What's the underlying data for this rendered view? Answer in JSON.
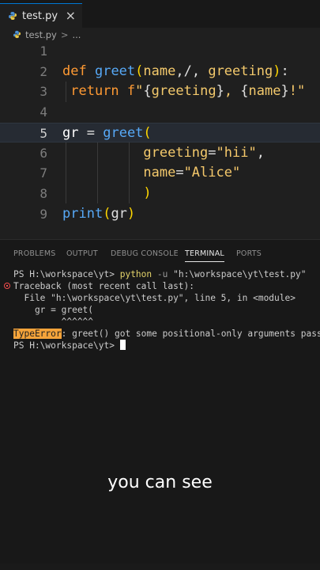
{
  "tab": {
    "label": "test.py",
    "close": "×"
  },
  "breadcrumb": {
    "file": "test.py",
    "separator": ">",
    "more": "..."
  },
  "editor": {
    "lines": [
      {
        "num": "1"
      },
      {
        "num": "2"
      },
      {
        "num": "3"
      },
      {
        "num": "4"
      },
      {
        "num": "5"
      },
      {
        "num": "6"
      },
      {
        "num": "7"
      },
      {
        "num": "8"
      },
      {
        "num": "9"
      }
    ]
  },
  "panel": {
    "tabs": [
      "PROBLEMS",
      "OUTPUT",
      "DEBUG CONSOLE",
      "TERMINAL",
      "PORTS"
    ],
    "active_tab": "TERMINAL"
  },
  "terminal": {
    "prompt1": "PS H:\\workspace\\yt> ",
    "cmd_python": "python",
    "cmd_flag": " -u ",
    "cmd_path": "\"h:\\workspace\\yt\\test.py\"",
    "traceback": "Traceback (most recent call last):",
    "file_line": "  File \"h:\\workspace\\yt\\test.py\", line 5, in <module>",
    "code_line": "    gr = greet(",
    "carets": "         ^^^^^^",
    "error_type": "TypeError",
    "error_msg": ": greet() got some positional-only arguments passed",
    "prompt2": "PS H:\\workspace\\yt> "
  },
  "subtitle": "you can see",
  "colors": {
    "keyword": "#ff9a33",
    "function": "#57a9f7",
    "string": "#f5c86b",
    "accent": "#0078d4",
    "error": "#f14c4c"
  },
  "icons": [
    "python-file-icon",
    "close-icon",
    "error-circle-icon"
  ]
}
